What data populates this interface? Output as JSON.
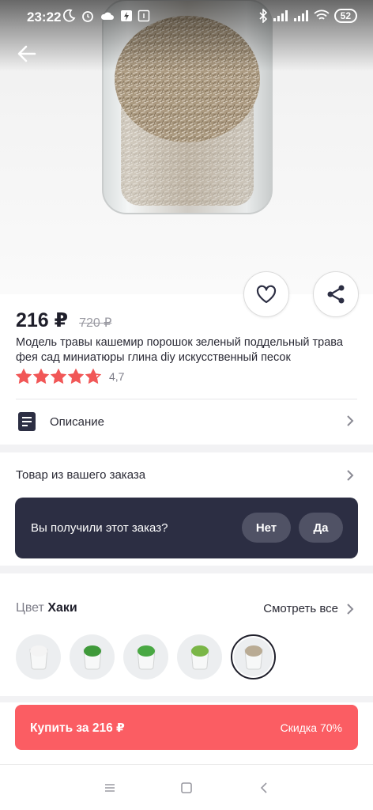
{
  "status_bar": {
    "time": "23:22",
    "battery": "52"
  },
  "product": {
    "price": "216 ₽",
    "old_price": "720 ₽",
    "title": "Модель травы кашемир порошок зеленый поддельный трава фея сад миниатюры глина diy искусственный песок",
    "rating_value": "4,7",
    "rating_stars": 4.7,
    "description_label": "Описание"
  },
  "order": {
    "title": "Товар из вашего заказа",
    "question": "Вы получили этот заказ?",
    "no_label": "Нет",
    "yes_label": "Да"
  },
  "color": {
    "label_key": "Цвет",
    "label_value": "Хаки",
    "see_all": "Смотреть все",
    "swatches": [
      {
        "name": "white",
        "fill": "#f4f4f4"
      },
      {
        "name": "green",
        "fill": "#3f9a3a"
      },
      {
        "name": "green-2",
        "fill": "#49a843"
      },
      {
        "name": "light-green",
        "fill": "#7ab647"
      },
      {
        "name": "khaki",
        "fill": "#b9ab94",
        "selected": true
      }
    ]
  },
  "buy": {
    "label": "Купить за 216 ₽",
    "discount": "Скидка 70%"
  },
  "colors": {
    "accent": "#fb5d63",
    "dark_panel": "#2c2e43",
    "star": "#f15757"
  }
}
